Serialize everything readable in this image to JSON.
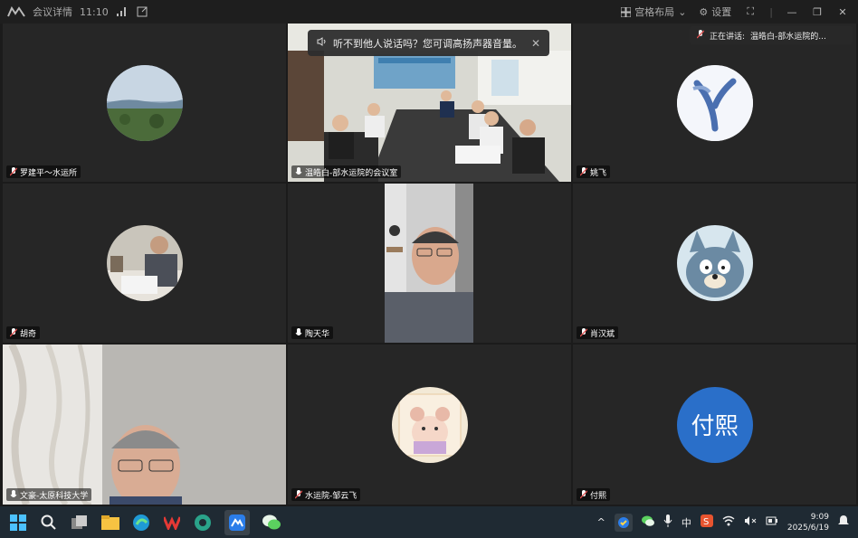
{
  "topbar": {
    "meeting_details": "会议详情",
    "duration": "11:10",
    "layout_label": "宫格布局",
    "settings_label": "设置"
  },
  "notice": {
    "text": "听不到他人说话吗？您可调高扬声器音量。",
    "close": "✕"
  },
  "speaking": {
    "label": "正在讲话:",
    "name": "温皓白-部水运院的..."
  },
  "participants": [
    {
      "name": "罗建平～水运所",
      "mic": "muted"
    },
    {
      "name": "温皓白-部水运院的会议室",
      "mic": "on"
    },
    {
      "name": "姚飞",
      "mic": "muted"
    },
    {
      "name": "胡奇",
      "mic": "muted"
    },
    {
      "name": "陶天华",
      "mic": "on"
    },
    {
      "name": "肖汉斌",
      "mic": "muted"
    },
    {
      "name": "文豪-太原科技大学",
      "mic": "on"
    },
    {
      "name": "水运院-邹云飞",
      "mic": "muted"
    },
    {
      "name": "付熙",
      "mic": "muted",
      "avatar_text": "付熙"
    }
  ],
  "taskbar": {
    "ime": "中",
    "time": "9:09",
    "date": "2025/6/19"
  },
  "colors": {
    "active_border": "#2fb36b",
    "avatar_blue": "#2a6fc9"
  }
}
